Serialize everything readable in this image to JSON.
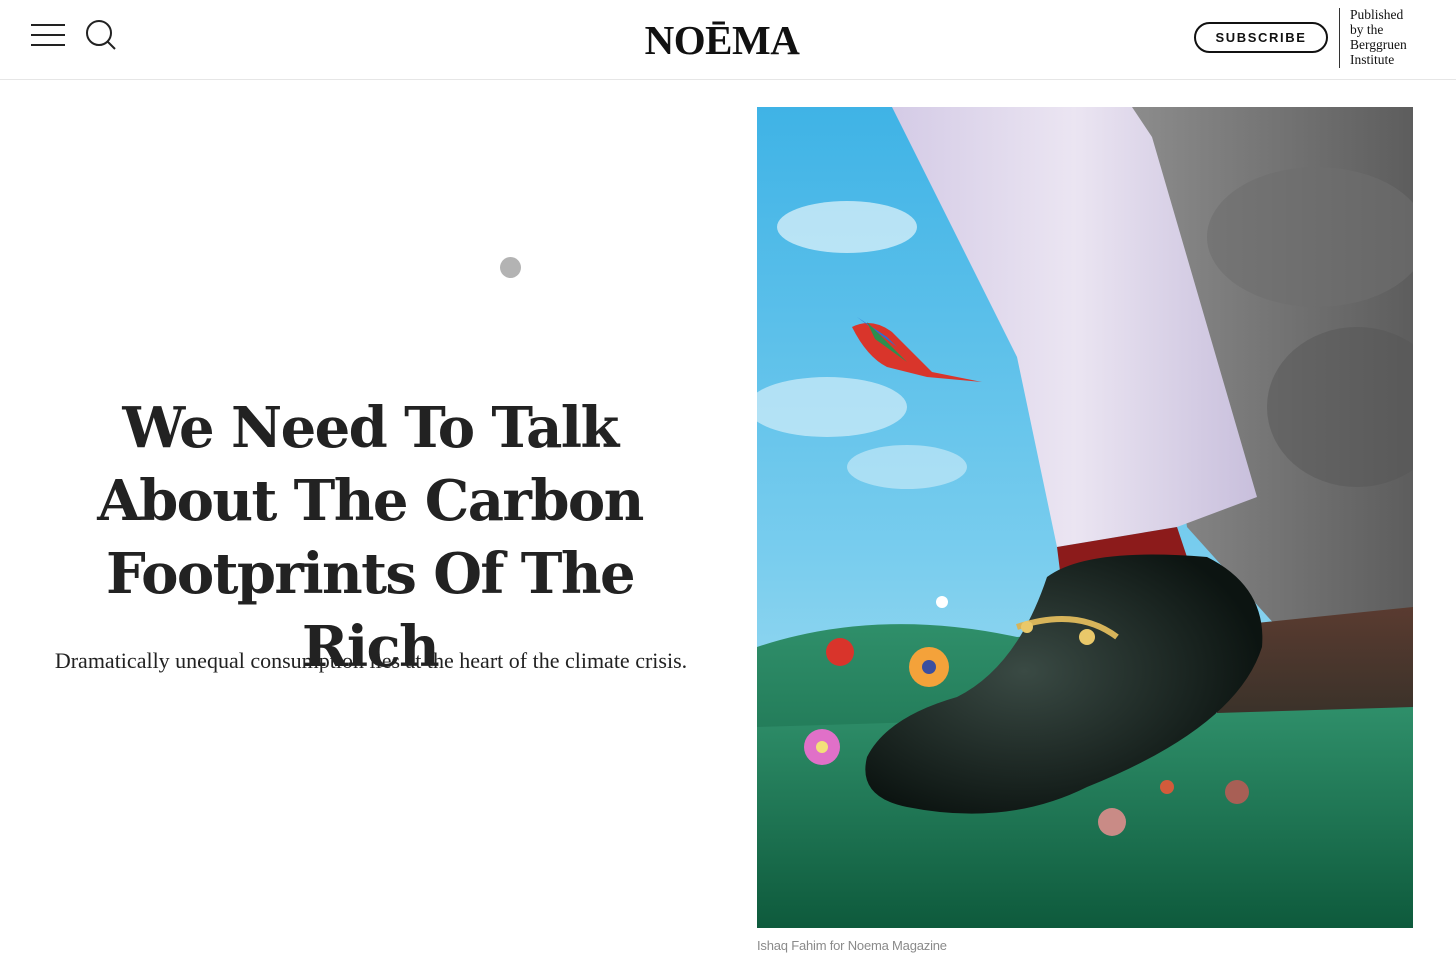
{
  "header": {
    "logo": "NOĒMA",
    "subscribe_label": "SUBSCRIBE",
    "publisher_lines": [
      "Published",
      "by the",
      "Berggruen",
      "Institute"
    ]
  },
  "icons": {
    "menu": "hamburger-menu-icon",
    "search": "search-icon"
  },
  "article": {
    "headline": "We Need To Talk About The Carbon Footprints Of The Rich",
    "dek": "Dramatically unequal consumption lies at the heart of the climate crisis.",
    "image_caption": "Ishaq Fahim for Noema Magazine"
  },
  "colors": {
    "text": "#222222",
    "caption": "#8a8a8a",
    "loading_dot": "#b3b3b3"
  }
}
